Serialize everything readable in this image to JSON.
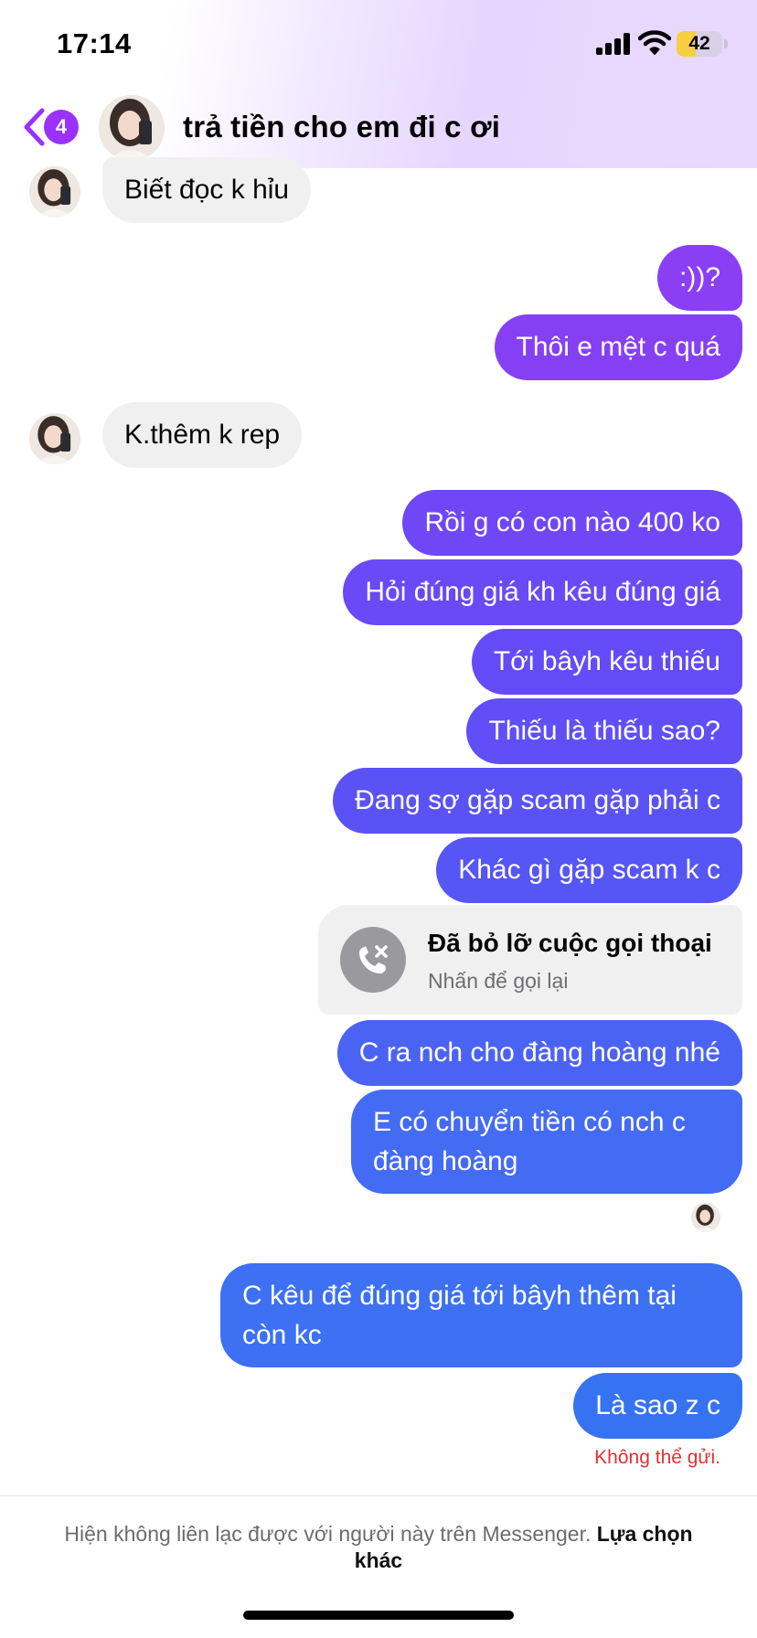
{
  "status_bar": {
    "time": "17:14",
    "battery": "42",
    "battery_level": 0.42
  },
  "header": {
    "back_badge": "4",
    "title": "trả tiền cho em đi c ơi"
  },
  "messages": [
    {
      "dir": "in",
      "text": "Biết đọc k hỉu"
    },
    {
      "dir": "out",
      "text": ":))?"
    },
    {
      "dir": "out",
      "text": "Thôi e mệt c quá"
    },
    {
      "dir": "in",
      "text": "K.thêm k rep"
    },
    {
      "dir": "out",
      "text": "Rồi g có con nào 400 ko"
    },
    {
      "dir": "out",
      "text": "Hỏi đúng giá kh kêu đúng giá"
    },
    {
      "dir": "out",
      "text": "Tới bâyh kêu thiếu"
    },
    {
      "dir": "out",
      "text": "Thiếu là thiếu sao?"
    },
    {
      "dir": "out",
      "text": "Đang sợ gặp scam gặp phải c"
    },
    {
      "dir": "out",
      "text": "Khác gì gặp scam k c"
    },
    {
      "dir": "out",
      "text": "C ra nch cho đàng hoàng nhé"
    },
    {
      "dir": "out",
      "text": "E có chuyển tiền có nch c đàng hoàng"
    },
    {
      "dir": "out",
      "text": "C kêu để đúng giá tới bâyh thêm tại còn kc"
    },
    {
      "dir": "out",
      "text": "Là sao z c"
    }
  ],
  "missed_call": {
    "title": "Đã bỏ lỡ cuộc gọi thoại",
    "subtitle": "Nhấn để gọi lại"
  },
  "send_error": "Không thể gửi.",
  "footer": {
    "note": "Hiện không liên lạc được với người này trên Messenger.",
    "link": "Lựa chọn khác"
  },
  "icons": {
    "back": "chevron-left-icon",
    "missed_call": "missed-call-icon",
    "signal": "cellular-signal-icon",
    "wifi": "wifi-icon",
    "battery": "battery-icon"
  },
  "colors": {
    "accent": "#9a31ff",
    "incoming_bubble": "#f0f0f0",
    "outgoing_gradient": [
      "#8a3ff5",
      "#6550f7",
      "#3f6bf3",
      "#3573f2"
    ],
    "error": "#e0322f"
  }
}
